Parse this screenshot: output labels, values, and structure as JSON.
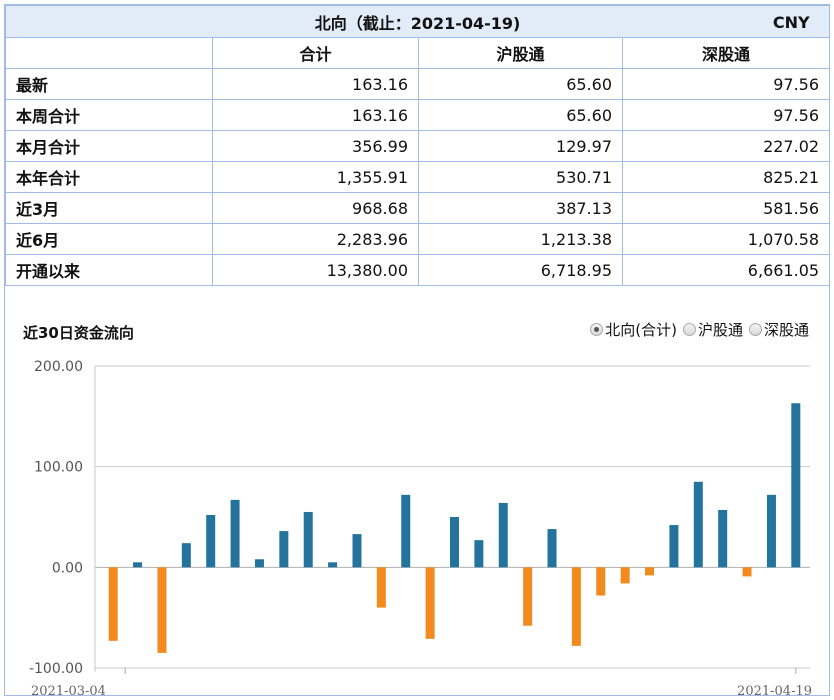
{
  "header": {
    "title": "北向（截止：2021-04-19)",
    "currency": "CNY"
  },
  "columns": [
    "合计",
    "沪股通",
    "深股通"
  ],
  "rows": [
    {
      "label": "最新",
      "values": [
        "163.16",
        "65.60",
        "97.56"
      ]
    },
    {
      "label": "本周合计",
      "values": [
        "163.16",
        "65.60",
        "97.56"
      ]
    },
    {
      "label": "本月合计",
      "values": [
        "356.99",
        "129.97",
        "227.02"
      ]
    },
    {
      "label": "本年合计",
      "values": [
        "1,355.91",
        "530.71",
        "825.21"
      ]
    },
    {
      "label": "近3月",
      "values": [
        "968.68",
        "387.13",
        "581.56"
      ]
    },
    {
      "label": "近6月",
      "values": [
        "2,283.96",
        "1,213.38",
        "1,070.58"
      ]
    },
    {
      "label": "开通以来",
      "values": [
        "13,380.00",
        "6,718.95",
        "6,661.05"
      ]
    }
  ],
  "chart_header": {
    "title": "近30日资金流向",
    "options": [
      {
        "label": "北向(合计)",
        "selected": true
      },
      {
        "label": "沪股通",
        "selected": false
      },
      {
        "label": "深股通",
        "selected": false
      }
    ]
  },
  "chart_data": {
    "type": "bar",
    "title": "近30日资金流向",
    "xlabel": "",
    "ylabel": "",
    "ylim": [
      -100,
      200
    ],
    "yticks": [
      "200.00",
      "100.00",
      "0.00",
      "-100.00"
    ],
    "x_tick_labels": [
      "2021-03-04",
      "2021-04-19"
    ],
    "colors": {
      "positive": "#24739c",
      "negative": "#f28a1e"
    },
    "series": [
      {
        "values": [
          -73,
          5,
          -85,
          24,
          52,
          67,
          8,
          36,
          55,
          5,
          33,
          -40,
          72,
          -71,
          50,
          27,
          64,
          -58,
          38,
          -78,
          -28,
          -16,
          -8,
          42,
          85,
          57,
          -9,
          72,
          163
        ]
      }
    ],
    "grid": true
  }
}
